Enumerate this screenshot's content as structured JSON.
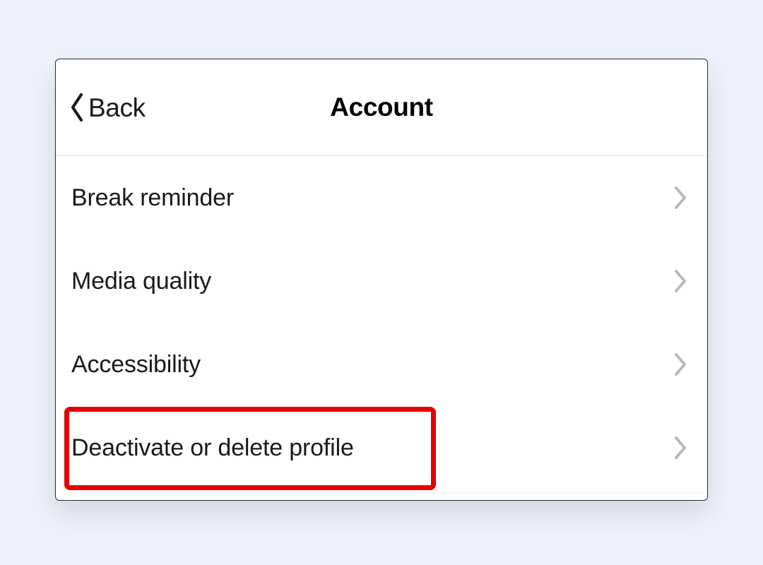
{
  "header": {
    "back_label": "Back",
    "title": "Account"
  },
  "list": {
    "items": [
      {
        "label": "Break reminder"
      },
      {
        "label": "Media quality"
      },
      {
        "label": "Accessibility"
      },
      {
        "label": "Deactivate or delete profile"
      }
    ]
  },
  "highlight": {
    "row_index": 3,
    "color": "#e60000"
  }
}
